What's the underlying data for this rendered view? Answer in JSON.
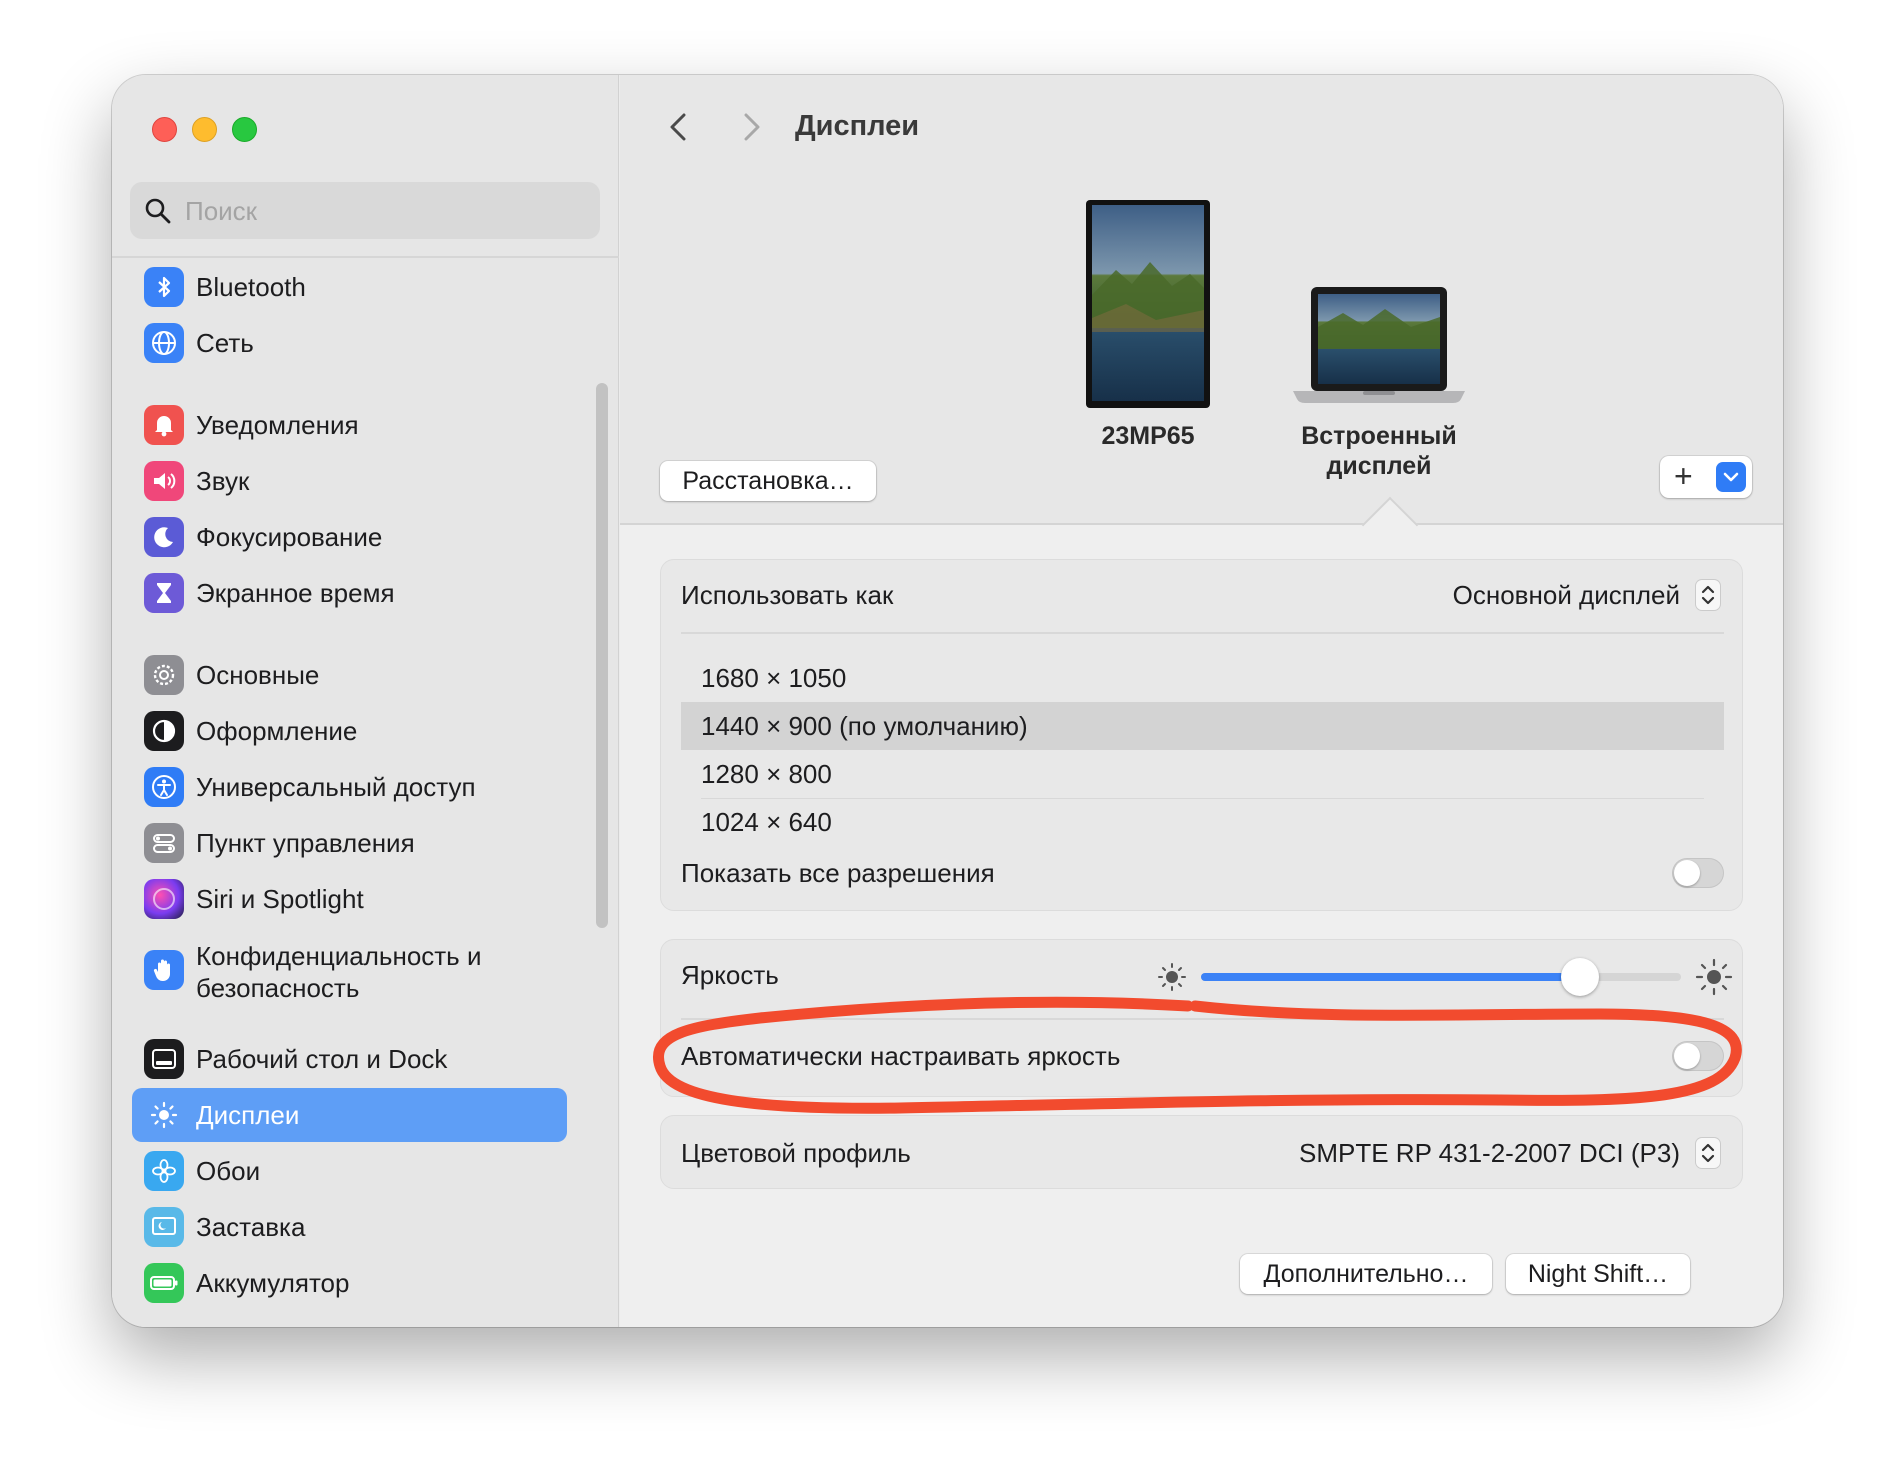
{
  "sidebar": {
    "search_placeholder": "Поиск",
    "items": [
      {
        "label": "Bluetooth",
        "icon": "bluetooth-icon",
        "color": "#3a82f7"
      },
      {
        "label": "Сеть",
        "icon": "globe-icon",
        "color": "#3a82f7"
      },
      {
        "label": "Уведомления",
        "icon": "bell-icon",
        "color": "#f0524f"
      },
      {
        "label": "Звук",
        "icon": "speaker-icon",
        "color": "#f0477a"
      },
      {
        "label": "Фокусирование",
        "icon": "moon-icon",
        "color": "#5b5bd6"
      },
      {
        "label": "Экранное время",
        "icon": "hourglass-icon",
        "color": "#6d5ad7"
      },
      {
        "label": "Основные",
        "icon": "gear-icon",
        "color": "#8e8e93"
      },
      {
        "label": "Оформление",
        "icon": "appearance-icon",
        "color": "#1c1c1e"
      },
      {
        "label": "Универсальный доступ",
        "icon": "accessibility-icon",
        "color": "#2f7cf6"
      },
      {
        "label": "Пункт управления",
        "icon": "control-center-icon",
        "color": "#8e8e93"
      },
      {
        "label": "Siri и Spotlight",
        "icon": "siri-icon",
        "color": "#b24ad8"
      },
      {
        "label": "Конфиденциальность и безопасность",
        "icon": "hand-icon",
        "color": "#3a82f7"
      },
      {
        "label": "Рабочий стол и Dock",
        "icon": "dock-icon",
        "color": "#1c1c1e"
      },
      {
        "label": "Дисплеи",
        "icon": "sun-icon",
        "color": "#3a82f7"
      },
      {
        "label": "Обои",
        "icon": "flower-icon",
        "color": "#39a8f0"
      },
      {
        "label": "Заставка",
        "icon": "screensaver-icon",
        "color": "#59b9e8"
      },
      {
        "label": "Аккумулятор",
        "icon": "battery-icon",
        "color": "#34c759"
      }
    ]
  },
  "main": {
    "title": "Дисплеи",
    "arrange_button": "Расстановка…",
    "monitors": [
      {
        "name": "23MP65"
      },
      {
        "name": "Встроенный дисплей"
      }
    ],
    "add_button": "+",
    "use_as": {
      "label": "Использовать как",
      "value": "Основной дисплей"
    },
    "resolutions": [
      "1680 × 1050",
      "1440 × 900 (по умолчанию)",
      "1280 × 800",
      "1024 × 640"
    ],
    "selected_resolution_index": 1,
    "show_all_resolutions": {
      "label": "Показать все разрешения",
      "on": false
    },
    "brightness": {
      "label": "Яркость",
      "value": 0.79
    },
    "auto_brightness": {
      "label": "Автоматически настраивать яркость",
      "on": false
    },
    "color_profile": {
      "label": "Цветовой профиль",
      "value": "SMPTE RP 431-2-2007 DCI (P3)"
    },
    "advanced_button": "Дополнительно…",
    "night_shift_button": "Night Shift…",
    "help_button": "?"
  },
  "colors": {
    "accent": "#3b82f6",
    "selection": "#5e9ef6",
    "annotation": "#f24b2e"
  }
}
